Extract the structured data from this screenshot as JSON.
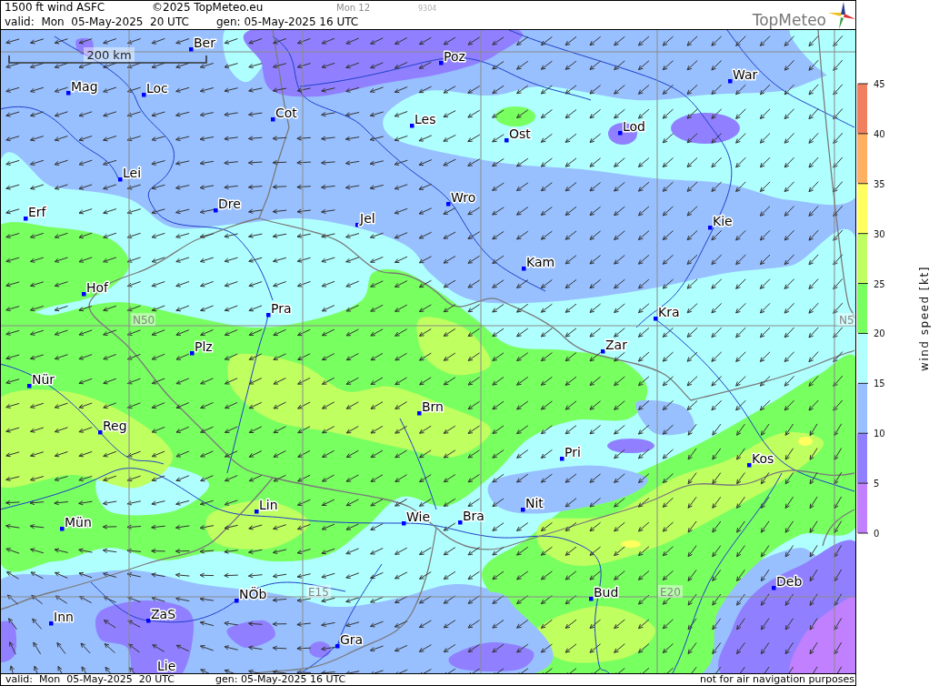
{
  "header": {
    "title": "1500 ft wind ASFC",
    "copyright": "©2025 TopMeteo.eu",
    "run_label": "Mon 12",
    "code": "9304",
    "valid": "valid:  Mon  05-May-2025  20 UTC",
    "generated": "gen: 05-May-2025 16 UTC",
    "logo_text": "TopMeteo"
  },
  "map": {
    "scale_label": "200 km",
    "grid_labels": [
      "N50",
      "N5",
      "E15",
      "E20"
    ],
    "cities": [
      {
        "name": "Ber"
      },
      {
        "name": "Poz"
      },
      {
        "name": "War"
      },
      {
        "name": "Mag"
      },
      {
        "name": "Loc"
      },
      {
        "name": "Cot"
      },
      {
        "name": "Les"
      },
      {
        "name": "Lod"
      },
      {
        "name": "Ost"
      },
      {
        "name": "Lei"
      },
      {
        "name": "Wro"
      },
      {
        "name": "Dre"
      },
      {
        "name": "Erf"
      },
      {
        "name": "Jel"
      },
      {
        "name": "Kie"
      },
      {
        "name": "Kam"
      },
      {
        "name": "Hof"
      },
      {
        "name": "Pra"
      },
      {
        "name": "Kra"
      },
      {
        "name": "Plz"
      },
      {
        "name": "Zar"
      },
      {
        "name": "Nür"
      },
      {
        "name": "Brn"
      },
      {
        "name": "Reg"
      },
      {
        "name": "Pri"
      },
      {
        "name": "Kos"
      },
      {
        "name": "Lin"
      },
      {
        "name": "Nit"
      },
      {
        "name": "Mün"
      },
      {
        "name": "Wie"
      },
      {
        "name": "Bra"
      },
      {
        "name": "Deb"
      },
      {
        "name": "Bud"
      },
      {
        "name": "NÖb"
      },
      {
        "name": "Inn"
      },
      {
        "name": "ZaS"
      },
      {
        "name": "Gra"
      },
      {
        "name": "Lie"
      }
    ]
  },
  "legend": {
    "title": "wind speed [kt]",
    "bands": [
      {
        "color": "#f08060"
      },
      {
        "color": "#ffb060"
      },
      {
        "color": "#ffff60"
      },
      {
        "color": "#c0ff60"
      },
      {
        "color": "#78ff60"
      },
      {
        "color": "#b0ffff"
      },
      {
        "color": "#98c0ff"
      },
      {
        "color": "#9080ff"
      },
      {
        "color": "#c080ff"
      }
    ],
    "ticks": [
      "45",
      "40",
      "35",
      "30",
      "25",
      "20",
      "15",
      "10",
      "5",
      "0"
    ]
  },
  "footer": {
    "valid": "valid:  Mon  05-May-2025  20 UTC",
    "generated": "gen: 05-May-2025 16 UTC",
    "disclaimer": "not for air navigation purposes"
  }
}
